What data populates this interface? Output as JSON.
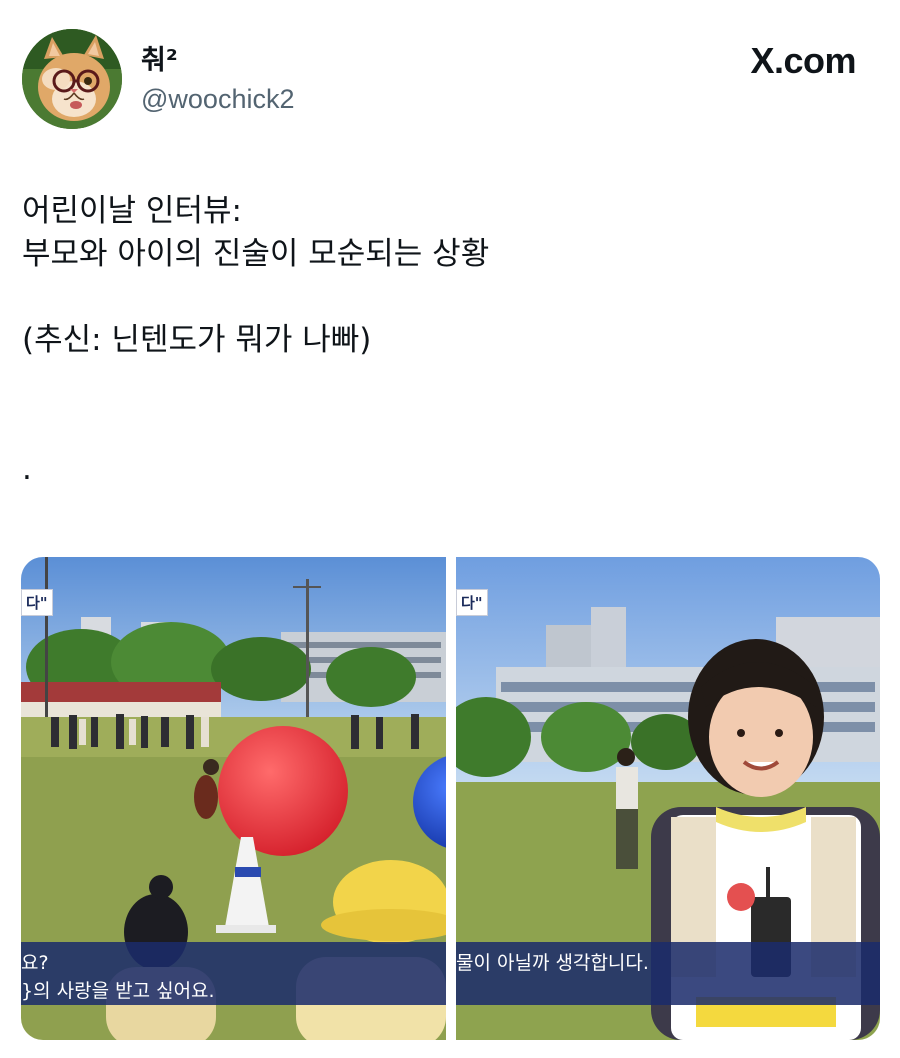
{
  "author": {
    "display_name": "춰²",
    "handle": "@woochick2",
    "avatar_icon": "kitten-with-glasses-avatar"
  },
  "site": {
    "brand": "X.com",
    "brand_glyph": "𝕏",
    "brand_suffix": ".com"
  },
  "tweet": {
    "lines": [
      "어린이날 인터뷰:",
      "부모와 아이의 진술이 모순되는 상황",
      "",
      "(추신: 닌텐도가 뭐가 나빠)",
      "",
      "."
    ]
  },
  "media": {
    "left_panel": {
      "badge": "다\"",
      "caption_line1": "요?",
      "caption_line2": "}의 사랑을 받고 싶어요."
    },
    "right_panel": {
      "badge": "다\"",
      "caption_line1": "물이 아닐까 생각합니다."
    },
    "caption_color": "#1b2b6b",
    "ball_red": "#e8333a",
    "ball_blue": "#1f4fd1"
  }
}
